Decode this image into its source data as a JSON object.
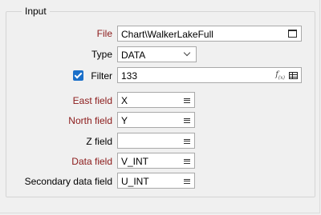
{
  "group": {
    "title": "Input"
  },
  "file": {
    "label": "File",
    "value": "Chart\\WalkerLakeFull"
  },
  "type": {
    "label": "Type",
    "value": "DATA"
  },
  "filter": {
    "label": "Filter",
    "checked": true,
    "value": "133",
    "fx_label": "f(x)"
  },
  "east": {
    "label": "East field",
    "value": "X"
  },
  "north": {
    "label": "North field",
    "value": "Y"
  },
  "z": {
    "label": "Z field",
    "value": ""
  },
  "data": {
    "label": "Data field",
    "value": "V_INT"
  },
  "secondary": {
    "label": "Secondary data field",
    "value": "U_INT"
  },
  "colors": {
    "required_label": "#8b1a1a",
    "checkbox": "#1a6fc9"
  }
}
